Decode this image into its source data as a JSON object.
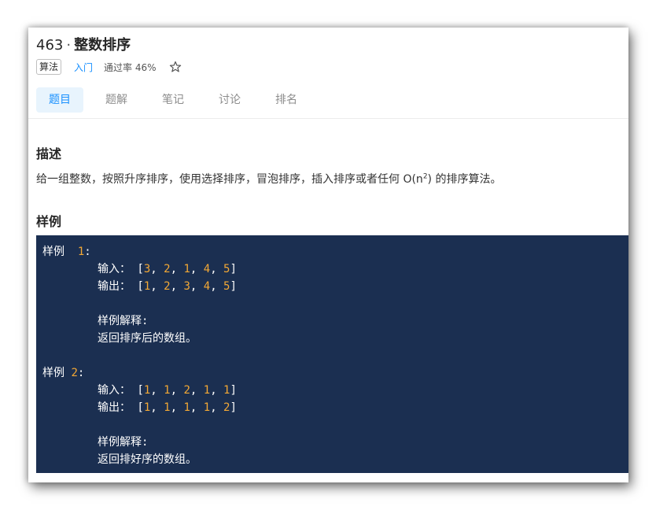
{
  "problem": {
    "number": "463",
    "separator": "·",
    "name": "整数排序",
    "tag": "算法",
    "level": "入门",
    "pass_rate": "通过率 46%"
  },
  "tabs": [
    {
      "label": "题目",
      "active": true
    },
    {
      "label": "题解",
      "active": false
    },
    {
      "label": "笔记",
      "active": false
    },
    {
      "label": "讨论",
      "active": false
    },
    {
      "label": "排名",
      "active": false
    }
  ],
  "description": {
    "heading": "描述",
    "text_before": "给一组整数，按照升序排序，使用选择排序，冒泡排序，插入排序或者任何 O(n",
    "sup": "2",
    "text_after": ") 的排序算法。"
  },
  "examples": {
    "heading": "样例",
    "items": [
      {
        "label": "样例",
        "index": "1",
        "input_label": "输入：",
        "input_values": [
          "3",
          "2",
          "1",
          "4",
          "5"
        ],
        "output_label": "输出：",
        "output_values": [
          "1",
          "2",
          "3",
          "4",
          "5"
        ],
        "explain_label": "样例解释:",
        "explain_text": "返回排序后的数组。"
      },
      {
        "label": "样例",
        "index": "2",
        "input_label": "输入：",
        "input_values": [
          "1",
          "1",
          "2",
          "1",
          "1"
        ],
        "output_label": "输出：",
        "output_values": [
          "1",
          "1",
          "1",
          "1",
          "2"
        ],
        "explain_label": "样例解释:",
        "explain_text": "返回排好序的数组。"
      }
    ]
  },
  "colors": {
    "accent": "#1890ff",
    "code_bg": "#1b2f51",
    "code_number": "#f4a935"
  },
  "icons": {
    "favorite": "star-outline-icon"
  }
}
